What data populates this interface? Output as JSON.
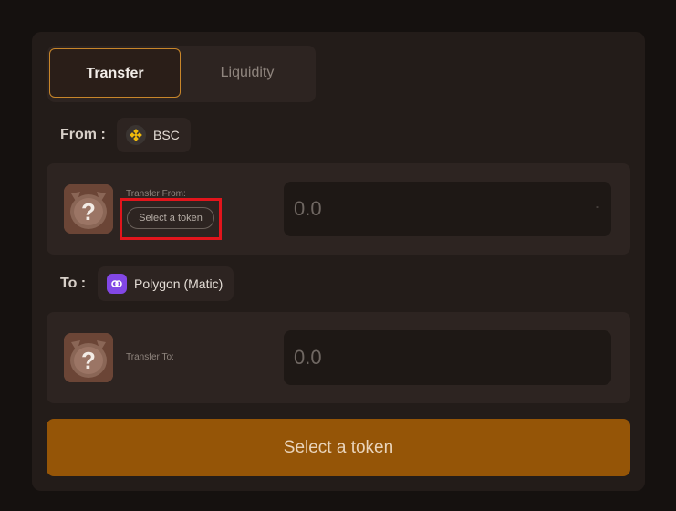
{
  "tabs": {
    "transfer": "Transfer",
    "liquidity": "Liquidity"
  },
  "from": {
    "label": "From :",
    "chain": "BSC",
    "chain_icon": "bnb-icon"
  },
  "to": {
    "label": "To :",
    "chain": "Polygon (Matic)",
    "chain_icon": "polygon-icon"
  },
  "from_card": {
    "label": "Transfer From:",
    "select_token": "Select a token",
    "amount_placeholder": "0.0",
    "balance": "-"
  },
  "to_card": {
    "label": "Transfer To:",
    "amount_placeholder": "0.0"
  },
  "action_button": "Select a token",
  "colors": {
    "accent": "#955507",
    "tab_border": "#c8862a",
    "highlight": "#e2151c"
  }
}
